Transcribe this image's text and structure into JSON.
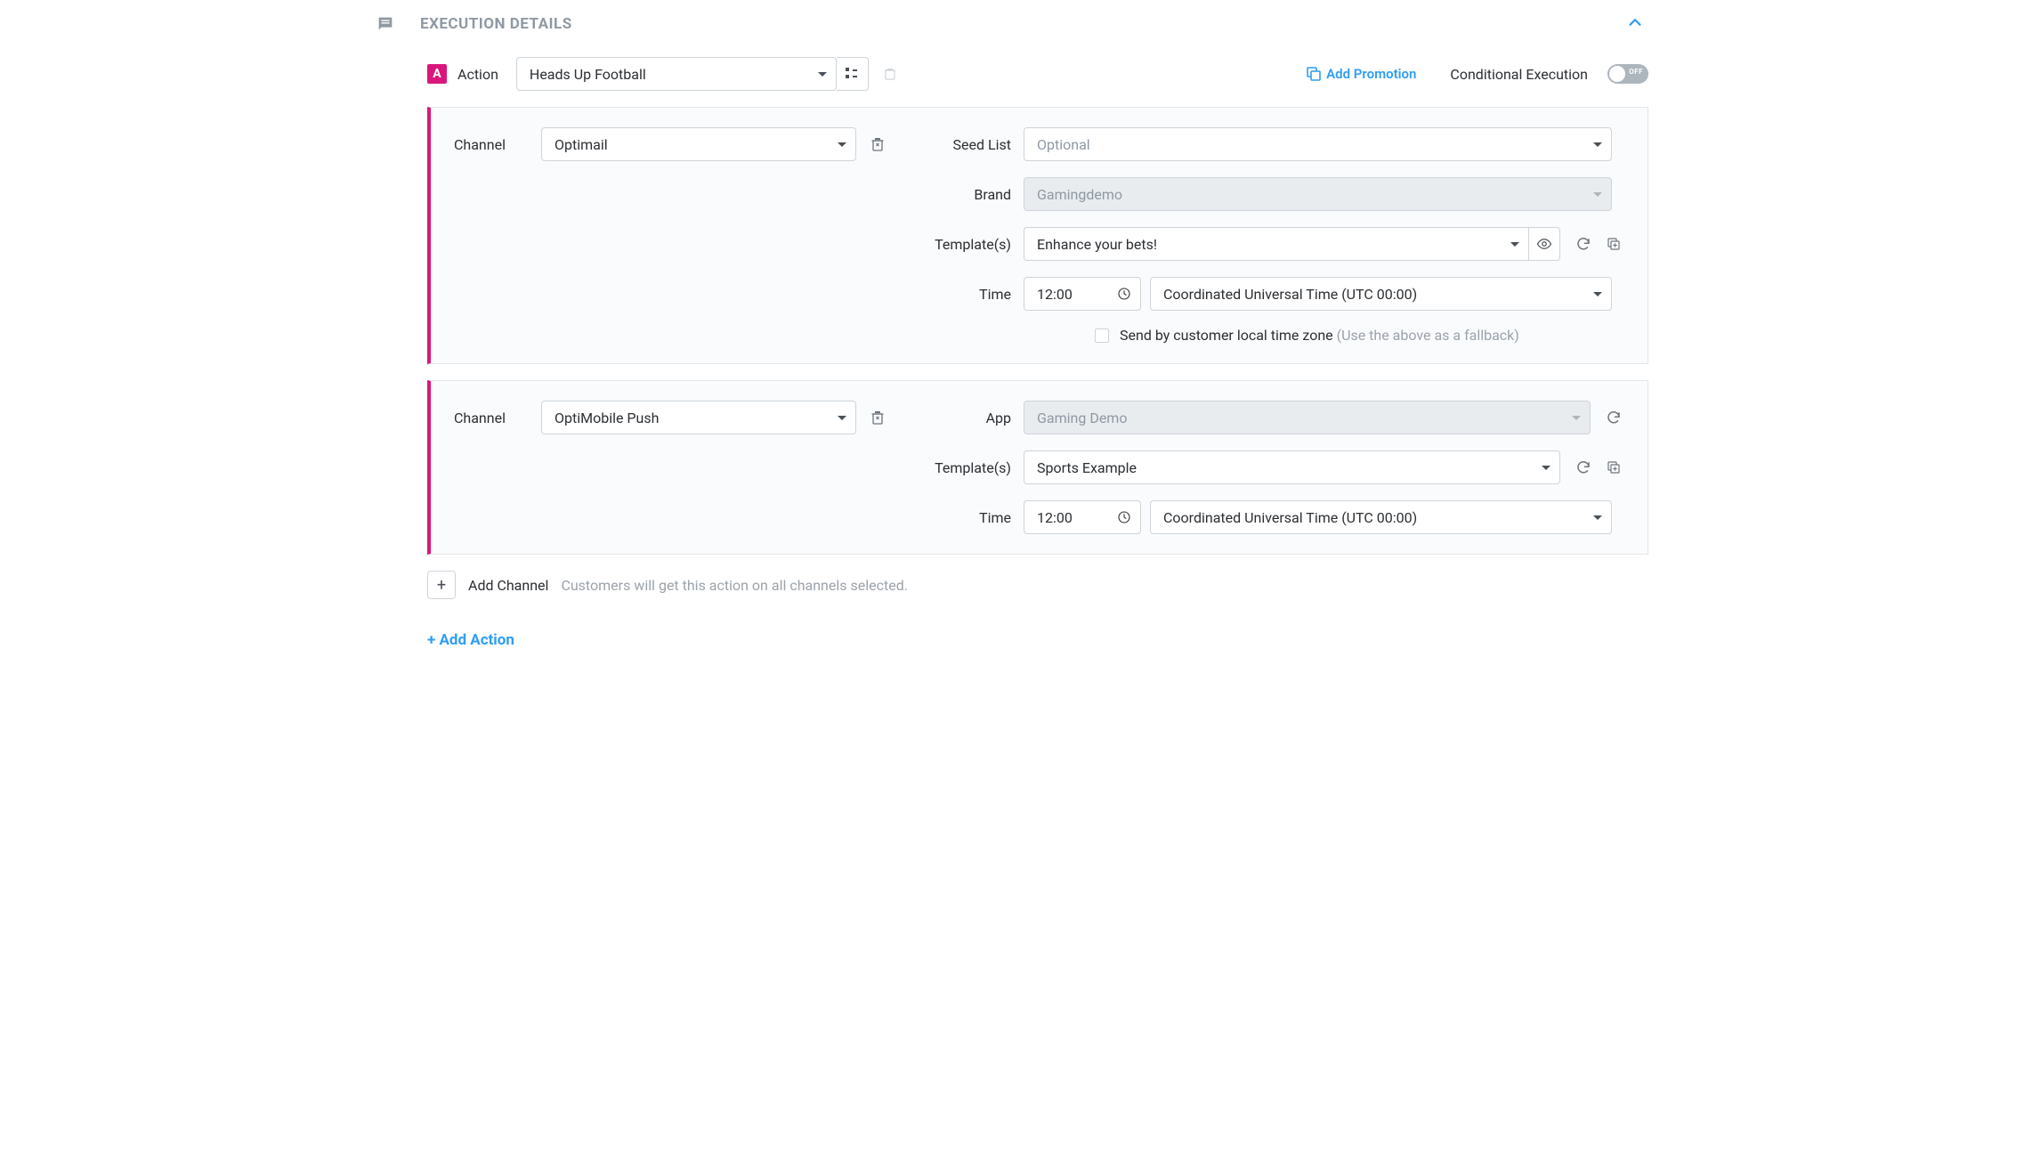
{
  "header": {
    "title": "EXECUTION DETAILS"
  },
  "actionRow": {
    "badge": "A",
    "label": "Action",
    "selected_action": "Heads Up Football",
    "add_promotion": "Add Promotion",
    "conditional_label": "Conditional Execution",
    "toggle_state": "OFF"
  },
  "channels": [
    {
      "channel_label": "Channel",
      "channel_value": "Optimail",
      "rows": [
        {
          "label": "Seed List",
          "type": "dropdown-placeholder",
          "value": "Optional"
        },
        {
          "label": "Brand",
          "type": "dropdown-disabled",
          "value": "Gamingdemo"
        },
        {
          "label": "Template(s)",
          "type": "template-eye",
          "value": "Enhance your bets!"
        },
        {
          "label": "Time",
          "type": "time",
          "time_value": "12:00",
          "tz_value": "Coordinated Universal Time (UTC 00:00)"
        }
      ],
      "local_time": {
        "checkbox_label": "Send by customer local time zone",
        "hint": "(Use the above as a fallback)"
      }
    },
    {
      "channel_label": "Channel",
      "channel_value": "OptiMobile Push",
      "rows": [
        {
          "label": "App",
          "type": "dropdown-disabled-refresh",
          "value": "Gaming Demo"
        },
        {
          "label": "Template(s)",
          "type": "template",
          "value": "Sports Example"
        },
        {
          "label": "Time",
          "type": "time",
          "time_value": "12:00",
          "tz_value": "Coordinated Universal Time (UTC 00:00)"
        }
      ]
    }
  ],
  "addChannel": {
    "label": "Add Channel",
    "hint": "Customers will get this action on all channels selected."
  },
  "addAction": {
    "label": "+ Add Action"
  }
}
